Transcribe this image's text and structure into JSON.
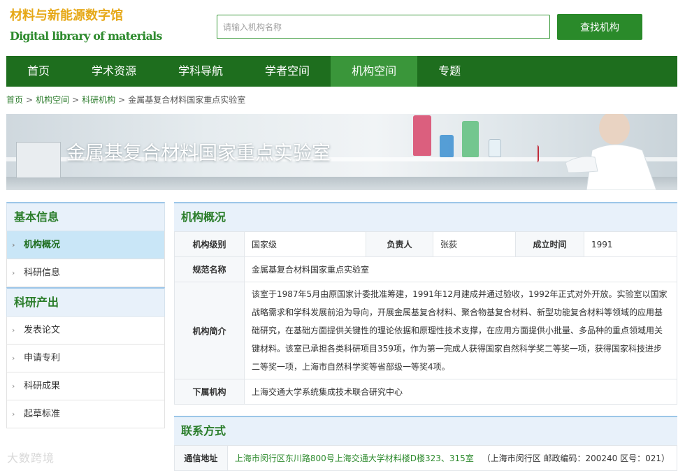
{
  "header": {
    "logo_cn": "材料与新能源数字馆",
    "logo_en": "Digital library of materials",
    "search_placeholder": "请输入机构名称",
    "search_button": "查找机构"
  },
  "nav": {
    "items": [
      "首页",
      "学术资源",
      "学科导航",
      "学者空间",
      "机构空间",
      "专题"
    ],
    "active": "机构空间"
  },
  "breadcrumb": [
    "首页",
    "机构空间",
    "科研机构",
    "金属基复合材料国家重点实验室"
  ],
  "banner": {
    "title": "金属基复合材料国家重点实验室"
  },
  "sidebar": {
    "sections": [
      {
        "title": "基本信息",
        "items": [
          "机构概况",
          "科研信息"
        ]
      },
      {
        "title": "科研产出",
        "items": [
          "发表论文",
          "申请专利",
          "科研成果",
          "起草标准"
        ]
      }
    ],
    "active": "机构概况"
  },
  "overview": {
    "title": "机构概况",
    "level_label": "机构级别",
    "level": "国家级",
    "leader_label": "负责人",
    "leader": "张荻",
    "founded_label": "成立时间",
    "founded": "1991",
    "name_label": "规范名称",
    "name": "金属基复合材料国家重点实验室",
    "intro_label": "机构简介",
    "intro": "该室于1987年5月由原国家计委批准筹建，1991年12月建成并通过验收，1992年正式对外开放。实验室以国家战略需求和学科发展前沿为导向，开展金属基复合材料、聚合物基复合材料、新型功能复合材料等领域的应用基础研究，在基础方面提供关键性的理论依据和原理性技术支撑，在应用方面提供小批量、多品种的重点领域用关键材料。该室已承担各类科研项目359项，作为第一完成人获得国家自然科学奖二等奖一项，获得国家科技进步二等奖一项，上海市自然科学奖等省部级一等奖4项。",
    "sub_label": "下属机构",
    "sub": "上海交通大学系统集成技术联合研究中心"
  },
  "contact": {
    "title": "联系方式",
    "address_label": "通信地址",
    "address_link": "上海市闵行区东川路800号上海交通大学材料楼D楼323、315室",
    "address_extra": "（上海市闵行区 邮政编码：200240 区号：021）"
  },
  "watermark": "大数跨境",
  "colors": {
    "nav_bg": "#1e6e1e",
    "nav_active": "#3a963a",
    "accent_green": "#2a8a2a",
    "logo_orange": "#e6a817"
  }
}
